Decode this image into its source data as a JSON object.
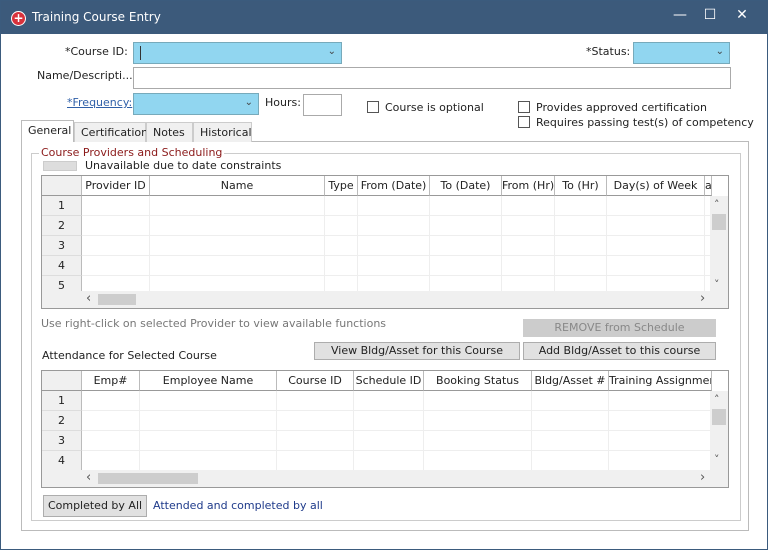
{
  "window": {
    "title": "Training Course Entry",
    "minimize": "—",
    "maximize": "☐",
    "close": "✕"
  },
  "form": {
    "course_id_label": "*Course ID:",
    "course_id_value": "",
    "status_label": "*Status:",
    "status_value": "",
    "name_label": "Name/Descripti...",
    "name_value": "",
    "frequency_label": "*Frequency:",
    "frequency_value": "",
    "hours_label": "Hours:",
    "hours_value": "",
    "optional_label": "Course is optional",
    "approved_cert_label": "Provides approved certification",
    "requires_test_label": "Requires passing test(s) of competency"
  },
  "tabs": [
    "General",
    "Certification",
    "Notes",
    "Historical"
  ],
  "providers": {
    "group_title": "Course Providers and Scheduling",
    "legend_label": "Unavailable due to date constraints",
    "columns": [
      "Provider ID",
      "Name",
      "Type",
      "From (Date)",
      "To (Date)",
      "From (Hr)",
      "To (Hr)",
      "Day(s) of Week",
      "a"
    ],
    "rows": [
      "1",
      "2",
      "3",
      "4",
      "5"
    ],
    "hint": "Use right-click on selected Provider to view available functions",
    "remove_button": "REMOVE from Schedule"
  },
  "attendance": {
    "title": "Attendance for Selected Course",
    "view_button": "View Bldg/Asset for this Course",
    "add_button": "Add Bldg/Asset to this course",
    "columns": [
      "Emp#",
      "Employee Name",
      "Course ID",
      "Schedule ID",
      "Booking Status",
      "Bldg/Asset #",
      "Training Assignment"
    ],
    "rows": [
      "1",
      "2",
      "3",
      "4"
    ],
    "completed_button": "Completed by All",
    "completed_text": "Attended and completed by all"
  },
  "icons": {
    "up": "˄",
    "down": "˅",
    "left": "‹",
    "right": "›",
    "dropdown": "⌄"
  }
}
